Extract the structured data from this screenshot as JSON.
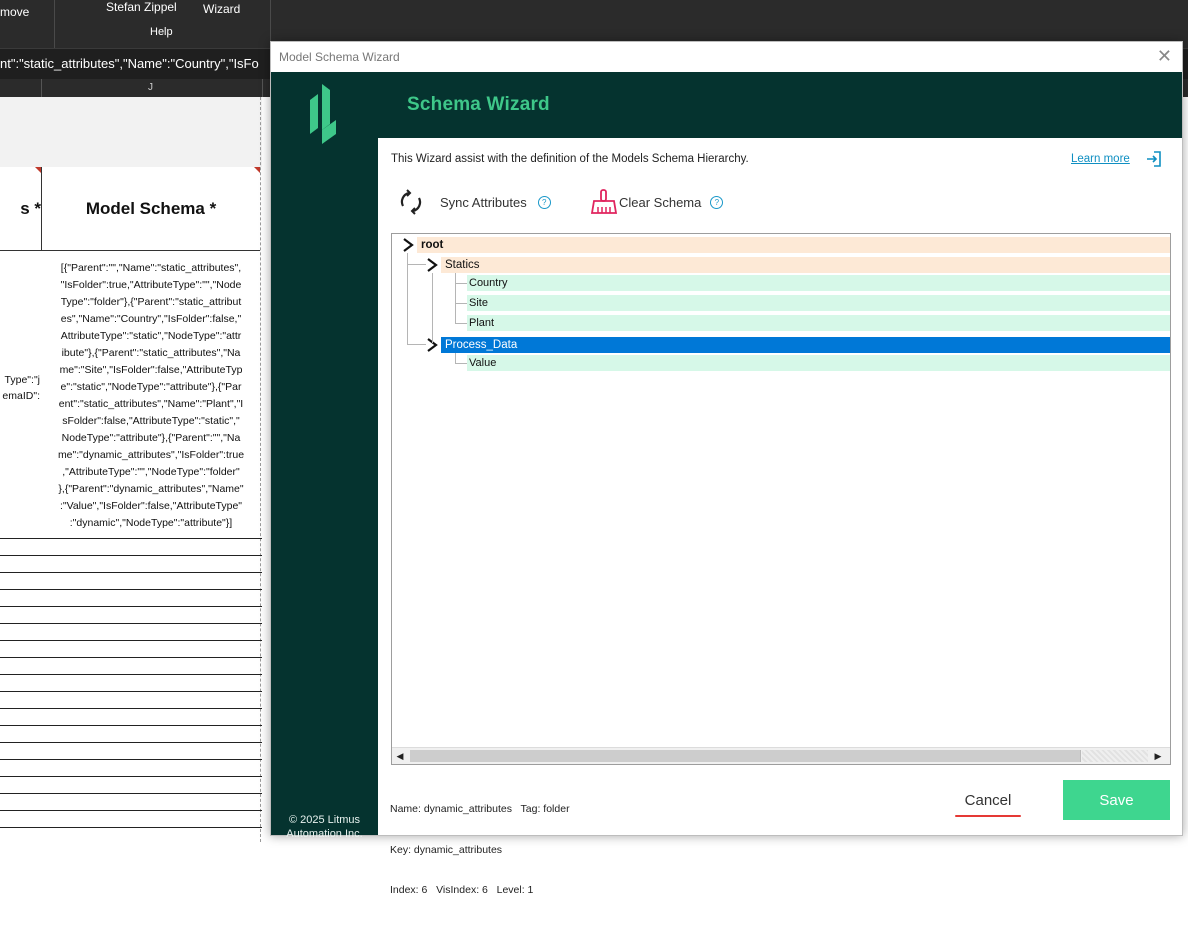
{
  "background": {
    "ribbon": {
      "frag_left": "move",
      "user": "Stefan Zippel",
      "wizard": "Wizard",
      "help": "Help"
    },
    "formula_text": "nt\":\"static_attributes\",\"Name\":\"Country\",\"IsFo",
    "column_letter": "J",
    "header_left": "s *",
    "header_model_schema": "Model Schema *",
    "left_fragments": [
      "Type\":\"j",
      "emaID\":"
    ],
    "json_lines": [
      "[{\"Parent\":\"\",\"Name\":\"static_attributes\",",
      "\"IsFolder\":true,\"AttributeType\":\"\",\"Node",
      "Type\":\"folder\"},{\"Parent\":\"static_attribut",
      "es\",\"Name\":\"Country\",\"IsFolder\":false,\"",
      "AttributeType\":\"static\",\"NodeType\":\"attr",
      "ibute\"},{\"Parent\":\"static_attributes\",\"Na",
      "me\":\"Site\",\"IsFolder\":false,\"AttributeTyp",
      "e\":\"static\",\"NodeType\":\"attribute\"},{\"Par",
      "ent\":\"static_attributes\",\"Name\":\"Plant\",\"I",
      "sFolder\":false,\"AttributeType\":\"static\",\"",
      "NodeType\":\"attribute\"},{\"Parent\":\"\",\"Na",
      "me\":\"dynamic_attributes\",\"IsFolder\":true",
      ",\"AttributeType\":\"\",\"NodeType\":\"folder\"",
      "},{\"Parent\":\"dynamic_attributes\",\"Name\"",
      ":\"Value\",\"IsFolder\":false,\"AttributeType\"",
      ":\"dynamic\",\"NodeType\":\"attribute\"}]"
    ]
  },
  "dialog": {
    "window_title": "Model Schema Wizard",
    "close_glyph": "✕",
    "heading": "Schema Wizard",
    "intro": "This Wizard assist with the definition of the Models Schema Hierarchy.",
    "learn_more": "Learn more",
    "toolbar": {
      "sync_label": "Sync Attributes",
      "clear_label": "Clear Schema",
      "help_glyph": "?"
    },
    "tree": {
      "root": "root",
      "statics": "Statics",
      "country": "Country",
      "site": "Site",
      "plant": "Plant",
      "process_data": "Process_Data",
      "value": "Value",
      "selected": "Process_Data"
    },
    "status": {
      "line1": "Name: dynamic_attributes   Tag: folder",
      "line2": "Key: dynamic_attributes",
      "line3": "Index: 6   VisIndex: 6   Level: 1"
    },
    "copyright": [
      "© 2025 Litmus",
      "Automation Inc."
    ],
    "cancel_label": "Cancel",
    "save_label": "Save",
    "colors": {
      "sidebar": "#05332f",
      "accent_green": "#3ec789",
      "save_button": "#3ed68f",
      "folder_highlight": "#fde9d6",
      "leaf_highlight": "#d6f8e8",
      "selected": "#0078d7",
      "cancel_underline": "#e53935",
      "link": "#0f8fc2"
    },
    "icons": [
      "litmus-logo-icon",
      "sync-icon",
      "broom-icon",
      "help-icon",
      "exit-arrow-icon",
      "chevron-right-icon"
    ]
  }
}
